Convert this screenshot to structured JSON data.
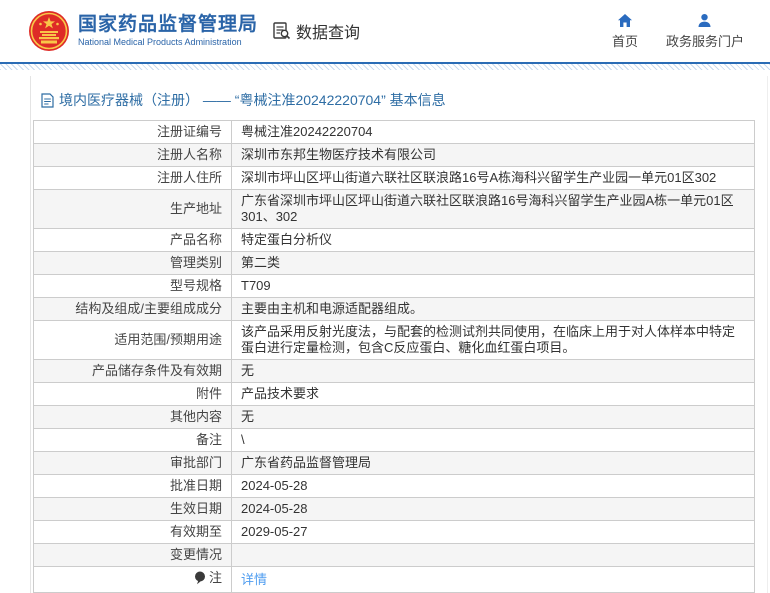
{
  "header": {
    "agency_name": "国家药品监督管理局",
    "agency_name_en": "National Medical Products Administration",
    "data_query_label": "数据查询",
    "nav": [
      {
        "label": "首页",
        "icon": "home-icon"
      },
      {
        "label": "政务服务门户",
        "icon": "person-icon"
      }
    ]
  },
  "breadcrumb": {
    "text": "境内医疗器械（注册） —— “粤械注准20242220704” 基本信息"
  },
  "table": {
    "rows": [
      {
        "label": "注册证编号",
        "value": "粤械注准20242220704"
      },
      {
        "label": "注册人名称",
        "value": "深圳市东邦生物医疗技术有限公司"
      },
      {
        "label": "注册人住所",
        "value": "深圳市坪山区坪山街道六联社区联浪路16号A栋海科兴留学生产业园一单元01区302"
      },
      {
        "label": "生产地址",
        "value": "广东省深圳市坪山区坪山街道六联社区联浪路16号海科兴留学生产业园A栋一单元01区301、302"
      },
      {
        "label": "产品名称",
        "value": "特定蛋白分析仪"
      },
      {
        "label": "管理类别",
        "value": "第二类"
      },
      {
        "label": "型号规格",
        "value": "T709"
      },
      {
        "label": "结构及组成/主要组成成分",
        "value": "主要由主机和电源适配器组成。"
      },
      {
        "label": "适用范围/预期用途",
        "value": "该产品采用反射光度法，与配套的检测试剂共同使用，在临床上用于对人体样本中特定蛋白进行定量检测，包含C反应蛋白、糖化血红蛋白项目。"
      },
      {
        "label": "产品储存条件及有效期",
        "value": "无"
      },
      {
        "label": "附件",
        "value": "产品技术要求"
      },
      {
        "label": "其他内容",
        "value": "无"
      },
      {
        "label": "备注",
        "value": "\\"
      },
      {
        "label": "审批部门",
        "value": "广东省药品监督管理局"
      },
      {
        "label": "批准日期",
        "value": "2024-05-28"
      },
      {
        "label": "生效日期",
        "value": "2024-05-28"
      },
      {
        "label": "有效期至",
        "value": "2029-05-27"
      },
      {
        "label": "变更情况",
        "value": ""
      },
      {
        "label": "注",
        "value": "详情",
        "value_is_link": true,
        "label_icon": "note-balloon-icon"
      }
    ]
  },
  "colors": {
    "brand_blue": "#2a64a8",
    "breadcrumb_blue": "#2e6da4",
    "link_blue": "#4f9df0",
    "separator_blue": "#2a6cb5",
    "row_alt_bg": "#f5f5f5",
    "table_border": "#cccccc",
    "emblem_red": "#de2b27",
    "emblem_gold": "#f9c648"
  }
}
